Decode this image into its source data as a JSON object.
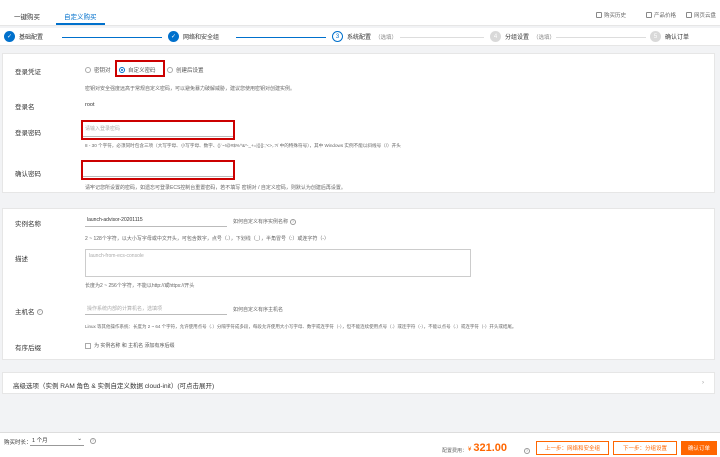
{
  "topbar": {
    "tabs": [
      "一键购买",
      "自定义购买"
    ],
    "tools": [
      "购买历史",
      "产品价格",
      "网页云盘"
    ]
  },
  "steps": [
    {
      "num": "✓",
      "label": "基础配置",
      "optional": ""
    },
    {
      "num": "✓",
      "label": "网络和安全组",
      "optional": ""
    },
    {
      "num": "3",
      "label": "系统配置",
      "optional": "（选填）"
    },
    {
      "num": "4",
      "label": "分组设置",
      "optional": "（选填）"
    },
    {
      "num": "5",
      "label": "确认订单",
      "optional": ""
    }
  ],
  "form": {
    "login_credential_label": "登录凭证",
    "radio_options": [
      "密钥对",
      "自定义密码",
      "创建后设置"
    ],
    "credential_hint": "密钥对安全强度远高于常规自定义密码，可以避免暴力破解威胁，建议您使用密钥对创建实例。",
    "login_name_label": "登录名",
    "login_name_value": "root",
    "password_label": "登录密码",
    "password_placeholder": "请输入登录密码",
    "password_hint": "8 - 30 个字符，必须同时包含三项（大写字母、小写字母、数字、()`~!@#$%^&*-_+=|{}[]:;'<>,.?/ 中的特殊符号），其中 Windows 实例不能以斜线号（/）开头",
    "confirm_label": "确认密码",
    "confirm_hint": "请牢记您所设置的密码，如遗忘可登录ECS控制台重置密码，若不填写 密钥对 / 自定义密码，则默认为创建后再设置。",
    "instance_name_label": "实例名称",
    "instance_name_value": "launch-advisor-20201115",
    "instance_name_side": "如何自定义有序实例名称",
    "instance_name_hint": "2 ~ 128个字符，以大小写字母或中文开头，可包含数字，点号（.），下划线（_），半角冒号（:）或连字符（-）",
    "desc_label": "描述",
    "desc_placeholder": "launch-from-ecs-console",
    "desc_hint": "长度为2 ~ 256个字符，不能以http://或https://开头",
    "hostname_label": "主机名",
    "hostname_placeholder": "操作系统内部的计算机名，选填项",
    "hostname_side": "如何自定义有序主机名",
    "hostname_hint": "Linux 等其他操作系统：长度为 2 ~ 64 个字符，允许使用点号（.）分隔字符成多段，每段允许使用大小写字母、数字或连字符（-），但不能连续使用点号（.）或连字符（-），不能以点号（.）或连字符（-）开头或结尾。",
    "ordered_label": "有序后缀",
    "ordered_check": "为 实例名称 和 主机名 添加有序后缀"
  },
  "advanced": {
    "label": "高级选项（实例 RAM 角色 & 实例自定义数据 cloud-init）(可点击展开)"
  },
  "footer": {
    "duration_label": "购买时长：",
    "duration_value": "1 个月",
    "price_label": "配置费用：",
    "currency": "¥",
    "price": "321.00",
    "prev_button": "上一步：网络和安全组",
    "next_button": "下一步：分组设置",
    "confirm_button": "确认订单"
  }
}
